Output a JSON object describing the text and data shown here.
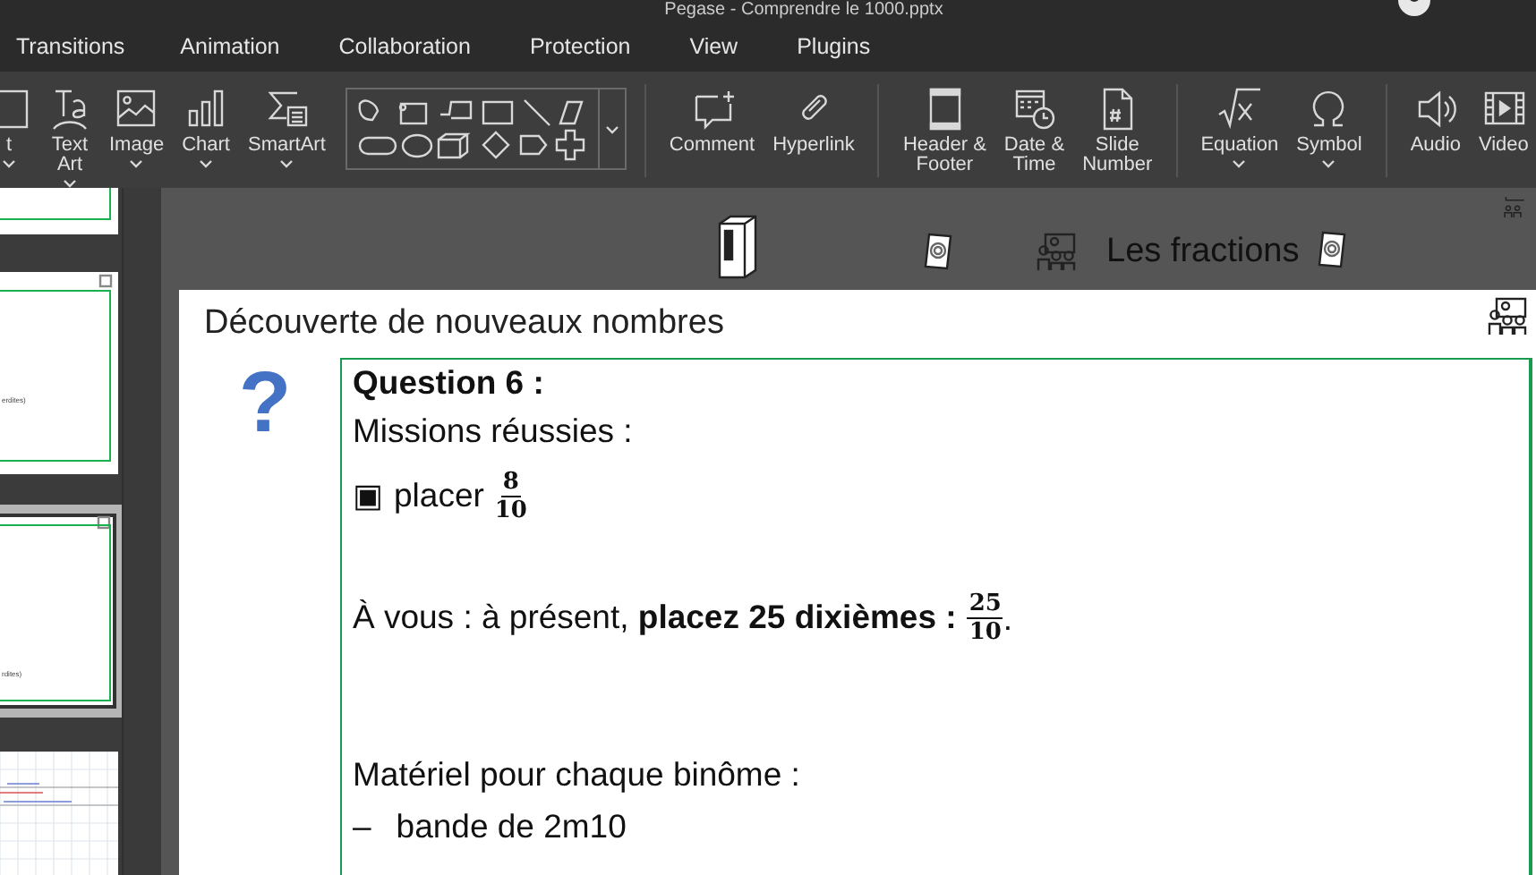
{
  "window": {
    "title": "Pegase - Comprendre le 1000.pptx"
  },
  "menu": [
    {
      "label": "Transitions"
    },
    {
      "label": "Animation"
    },
    {
      "label": "Collaboration"
    },
    {
      "label": "Protection"
    },
    {
      "label": "View"
    },
    {
      "label": "Plugins"
    }
  ],
  "toolbar": {
    "groups": [
      {
        "items": [
          {
            "kind": "button",
            "label": "t",
            "dropdown": true
          },
          {
            "kind": "button",
            "label": "Text\nArt",
            "dropdown": true
          },
          {
            "kind": "button",
            "label": "Image",
            "dropdown": true
          },
          {
            "kind": "button",
            "label": "Chart",
            "dropdown": true
          },
          {
            "kind": "button",
            "label": "SmartArt",
            "dropdown": true
          },
          {
            "kind": "gallery"
          }
        ]
      },
      {
        "items": [
          {
            "kind": "button",
            "label": "Comment",
            "dropdown": false
          },
          {
            "kind": "button",
            "label": "Hyperlink",
            "dropdown": false
          }
        ]
      },
      {
        "items": [
          {
            "kind": "button",
            "label": "Header &\nFooter",
            "dropdown": false
          },
          {
            "kind": "button",
            "label": "Date &\nTime",
            "dropdown": false
          },
          {
            "kind": "button",
            "label": "Slide\nNumber",
            "dropdown": false
          }
        ]
      },
      {
        "items": [
          {
            "kind": "button",
            "label": "Equation",
            "dropdown": true
          },
          {
            "kind": "button",
            "label": "Symbol",
            "dropdown": true
          }
        ]
      },
      {
        "items": [
          {
            "kind": "button",
            "label": "Audio",
            "dropdown": false
          },
          {
            "kind": "button",
            "label": "Video",
            "dropdown": false
          }
        ]
      }
    ]
  },
  "thumbnails": [
    {
      "kind": "partial",
      "selected": false
    },
    {
      "kind": "slide",
      "selected": false,
      "caption": "erdites)"
    },
    {
      "kind": "slide",
      "selected": true,
      "caption": "rdites)"
    },
    {
      "kind": "grid",
      "selected": false
    }
  ],
  "header_band": {
    "title": "Les fractions"
  },
  "slide": {
    "title": "Découverte de nouveaux nombres",
    "marker": "?",
    "lines": [
      {
        "kind": "heading",
        "text": "Question 6 :"
      },
      {
        "kind": "text",
        "text": "Missions réussies :"
      },
      {
        "kind": "check",
        "mark": "▣",
        "text": "placer",
        "fraction": {
          "num": "8",
          "den": "10"
        }
      },
      {
        "kind": "task",
        "text": "À vous : à présent, **placez 25 dixièmes :**",
        "fraction": {
          "num": "25",
          "den": "10"
        },
        "after": "."
      },
      {
        "kind": "list-intro",
        "text": "Matériel pour chaque binôme :"
      },
      {
        "kind": "bullet",
        "mark": "–",
        "text": "bande de 2m10"
      }
    ]
  }
}
